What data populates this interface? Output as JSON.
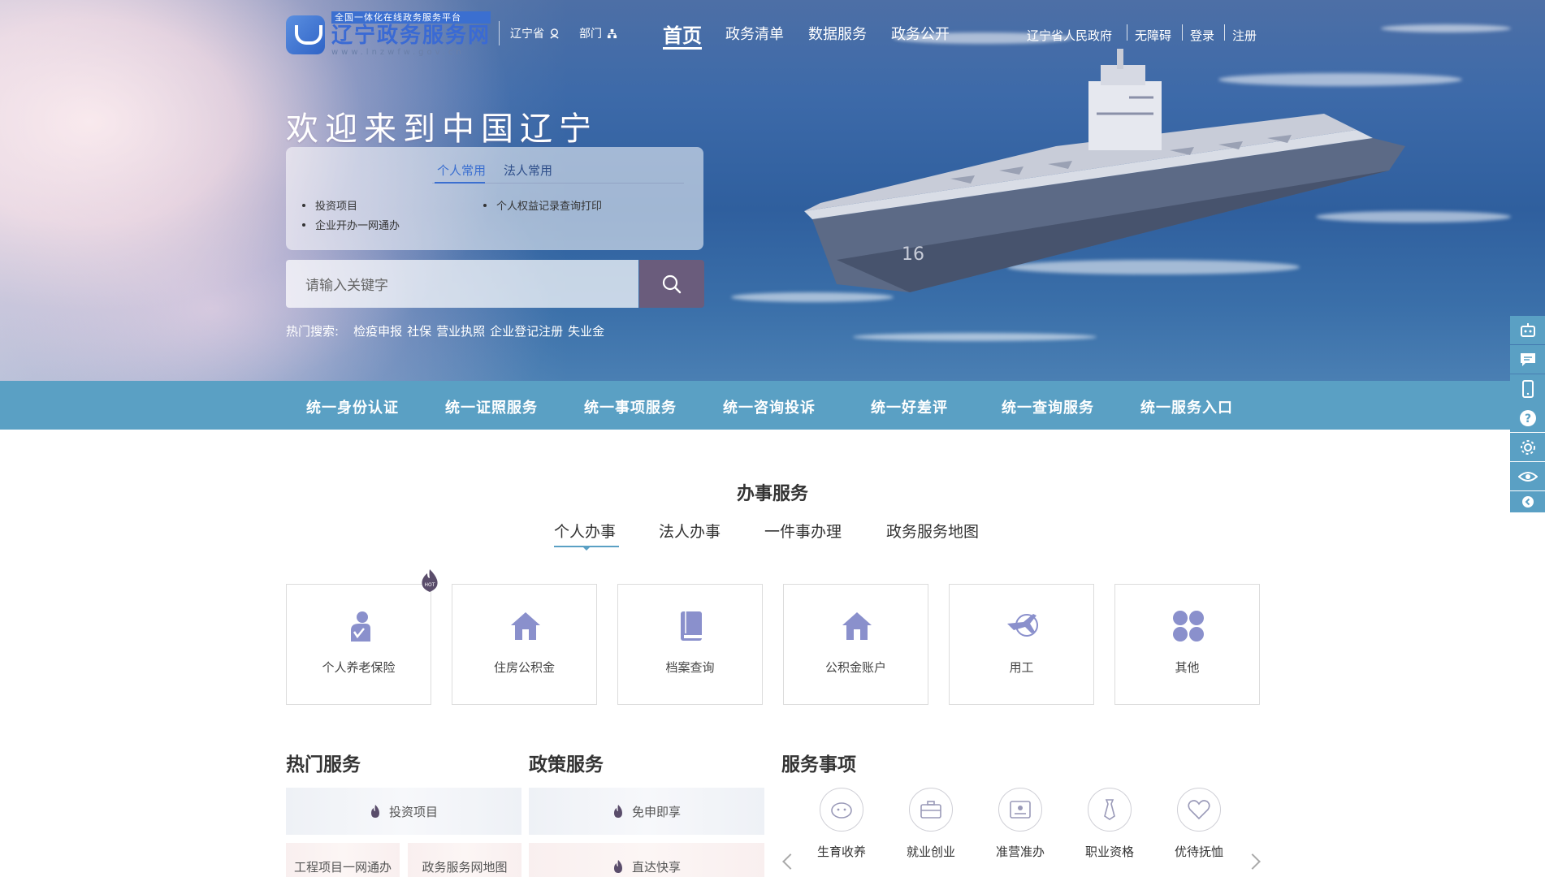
{
  "header": {
    "logo_sub": "全国一体化在线政务服务平台",
    "logo_main": "辽宁政务服务网",
    "logo_url": "www.lnzwfw.gov.cn",
    "region": "辽宁省",
    "department": "部门",
    "nav": [
      "首页",
      "政务清单",
      "数据服务",
      "政务公开"
    ],
    "links": [
      "辽宁省人民政府",
      "无障碍",
      "登录",
      "注册"
    ]
  },
  "hero": {
    "welcome": "欢迎来到中国辽宁",
    "common_tabs": [
      "个人常用",
      "法人常用"
    ],
    "common_items": [
      "投资项目",
      "个人权益记录查询打印",
      "企业开办一网通办"
    ],
    "search_placeholder": "请输入关键字",
    "hot_label": "热门搜索:",
    "hot_terms": [
      "检疫申报",
      "社保",
      "营业执照",
      "企业登记注册",
      "失业金"
    ]
  },
  "bluebar": [
    "统一身份认证",
    "统一证照服务",
    "统一事项服务",
    "统一咨询投诉",
    "统一好差评",
    "统一查询服务",
    "统一服务入口"
  ],
  "services": {
    "title": "办事服务",
    "tabs": [
      "个人办事",
      "法人办事",
      "一件事办理",
      "政务服务地图"
    ],
    "cards": [
      {
        "label": "个人养老保险",
        "icon": "elderly-care-icon",
        "hot": true
      },
      {
        "label": "住房公积金",
        "icon": "house-icon"
      },
      {
        "label": "档案查询",
        "icon": "book-icon"
      },
      {
        "label": "公积金账户",
        "icon": "house-icon"
      },
      {
        "label": "用工",
        "icon": "plane-icon"
      },
      {
        "label": "其他",
        "icon": "grid-icon"
      }
    ]
  },
  "bottom": {
    "hot_title": "热门服务",
    "policy_title": "政策服务",
    "items_title": "服务事项",
    "hot_items": [
      "投资项目",
      "工程项目一网通办",
      "政务服务网地图"
    ],
    "policy_items": [
      "免申即享",
      "直达快享"
    ],
    "service_items": [
      "生育收养",
      "就业创业",
      "准营准办",
      "职业资格",
      "优待抚恤"
    ]
  },
  "colors": {
    "accent": "#5aa0c4",
    "brand": "#3b6fd0",
    "search_button": "#6a5c7c",
    "icon": "#8a90cc"
  }
}
